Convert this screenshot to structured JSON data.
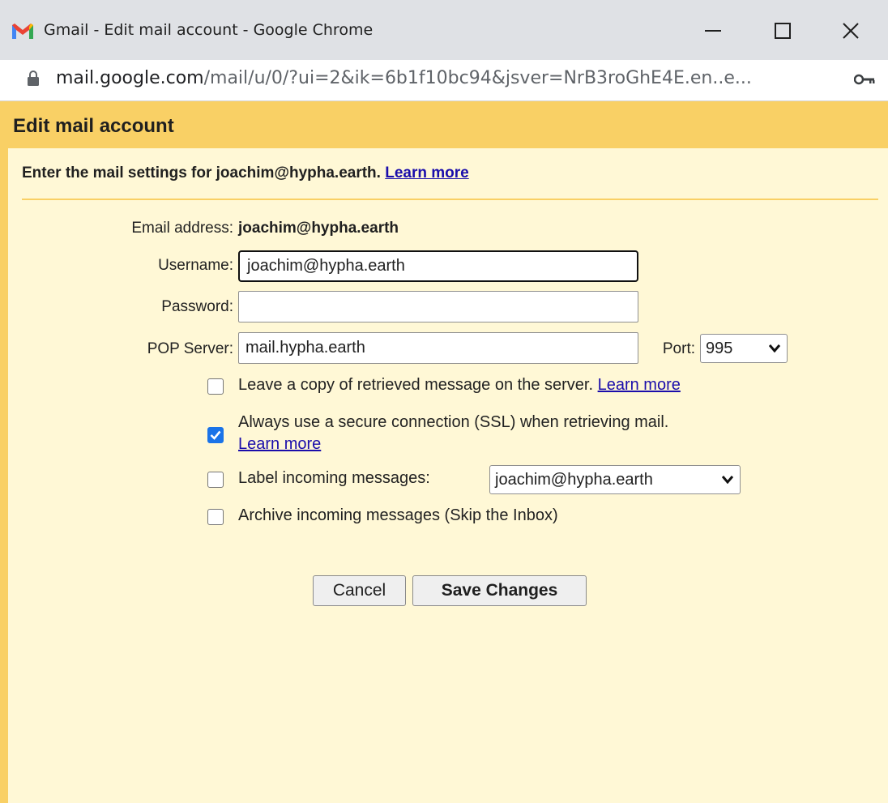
{
  "window": {
    "title": "Gmail - Edit mail account - Google Chrome",
    "url_host": "mail.google.com",
    "url_path": "/mail/u/0/?ui=2&ik=6b1f10bc94&jsver=NrB3roGhE4E.en..e...",
    "icons": [
      "gmail-logo-icon",
      "minimize-icon",
      "maximize-icon",
      "close-icon",
      "lock-icon",
      "key-icon"
    ]
  },
  "dialog": {
    "title": "Edit mail account",
    "intro_text": "Enter the mail settings for joachim@hypha.earth.",
    "intro_link": "Learn more"
  },
  "form": {
    "email_label": "Email address:",
    "email_value": "joachim@hypha.earth",
    "username_label": "Username:",
    "username_value": "joachim@hypha.earth",
    "password_label": "Password:",
    "password_value": "",
    "pop_label": "POP Server:",
    "pop_value": "mail.hypha.earth",
    "port_label": "Port:",
    "port_value": "995"
  },
  "options": [
    {
      "text": "Leave a copy of retrieved message on the server.",
      "link": "Learn more",
      "checked": false
    },
    {
      "text": "Always use a secure connection (SSL) when retrieving mail.",
      "link": "Learn more",
      "checked": true
    },
    {
      "text": "Label incoming messages:",
      "select_value": "joachim@hypha.earth",
      "checked": false
    },
    {
      "text": "Archive incoming messages (Skip the Inbox)",
      "checked": false
    }
  ],
  "buttons": {
    "cancel": "Cancel",
    "save": "Save Changes"
  },
  "colors": {
    "header": "#f9d065",
    "background": "#fff8d6",
    "link": "#1a0dab",
    "checkbox_checked": "#1a73e8"
  }
}
